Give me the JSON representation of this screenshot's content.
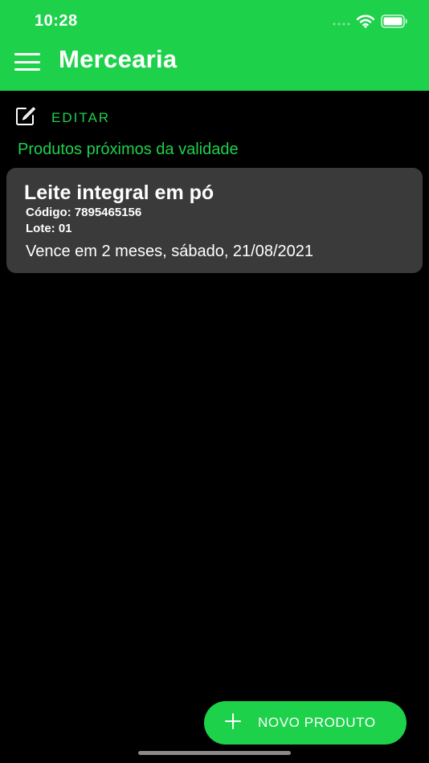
{
  "status_bar": {
    "time": "10:28",
    "icons": [
      "cellular-signal-icon",
      "wifi-icon",
      "battery-icon"
    ]
  },
  "header": {
    "title": "Mercearia",
    "menu_icon": "hamburger-menu-icon"
  },
  "toolbar": {
    "edit_label": "EDITAR",
    "edit_icon": "edit-square-icon"
  },
  "section": {
    "title": "Produtos próximos da validade"
  },
  "products": [
    {
      "name": "Leite integral em pó",
      "code": "Código: 7895465156",
      "batch": "Lote: 01",
      "expiry": "Vence em 2 meses, sábado, 21/08/2021"
    }
  ],
  "fab": {
    "label": "NOVO PRODUTO",
    "icon": "plus-icon"
  },
  "colors": {
    "accent": "#1ed14b",
    "background": "#000000",
    "card": "#3a3a3a"
  }
}
